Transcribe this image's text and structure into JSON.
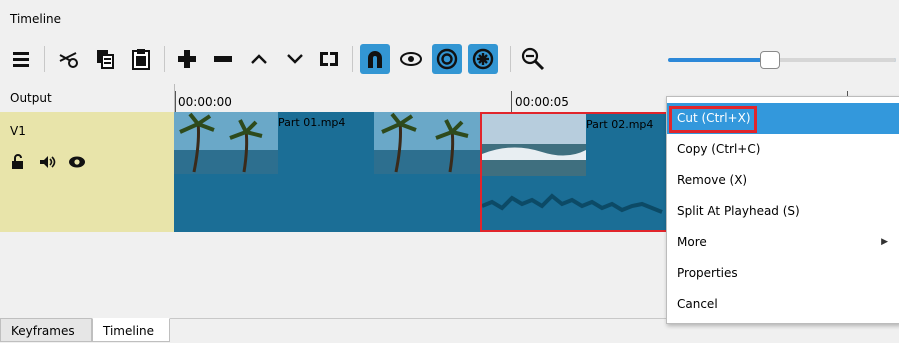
{
  "panel": {
    "title": "Timeline"
  },
  "toolbar": {
    "buttons": [
      {
        "icon": "menu-icon"
      },
      {
        "icon": "scissors-icon"
      },
      {
        "icon": "copy-icon"
      },
      {
        "icon": "paste-icon"
      },
      {
        "icon": "plus-icon"
      },
      {
        "icon": "minus-icon"
      },
      {
        "icon": "chevron-up-icon"
      },
      {
        "icon": "chevron-down-icon"
      },
      {
        "icon": "split-icon"
      },
      {
        "icon": "magnet-icon",
        "active": true
      },
      {
        "icon": "eye-icon"
      },
      {
        "icon": "target-icon",
        "active": true
      },
      {
        "icon": "ripple-icon",
        "active": true
      },
      {
        "icon": "zoom-out-icon"
      }
    ],
    "zoom_level": 0.44
  },
  "ruler": {
    "label": "Output",
    "ticks": [
      {
        "label": "00:00:00"
      },
      {
        "label": "00:00:05"
      }
    ]
  },
  "track": {
    "name": "V1",
    "clips": [
      {
        "name": "Part 01.mp4"
      },
      {
        "name": "Part 02.mp4"
      }
    ]
  },
  "context_menu": {
    "items": [
      {
        "label": "Cut (Ctrl+X)",
        "highlighted": true
      },
      {
        "label": "Copy (Ctrl+C)"
      },
      {
        "label": "Remove (X)"
      },
      {
        "label": "Split At Playhead (S)"
      },
      {
        "label": "More",
        "submenu": true
      },
      {
        "label": "Properties"
      },
      {
        "label": "Cancel"
      }
    ]
  },
  "tabs": [
    {
      "label": "Keyframes"
    },
    {
      "label": "Timeline",
      "active": true
    }
  ],
  "colors": {
    "accent": "#3396d3",
    "track_header": "#e8e4aa",
    "clip": "#1b6e96",
    "selection_border": "#e1252b"
  }
}
